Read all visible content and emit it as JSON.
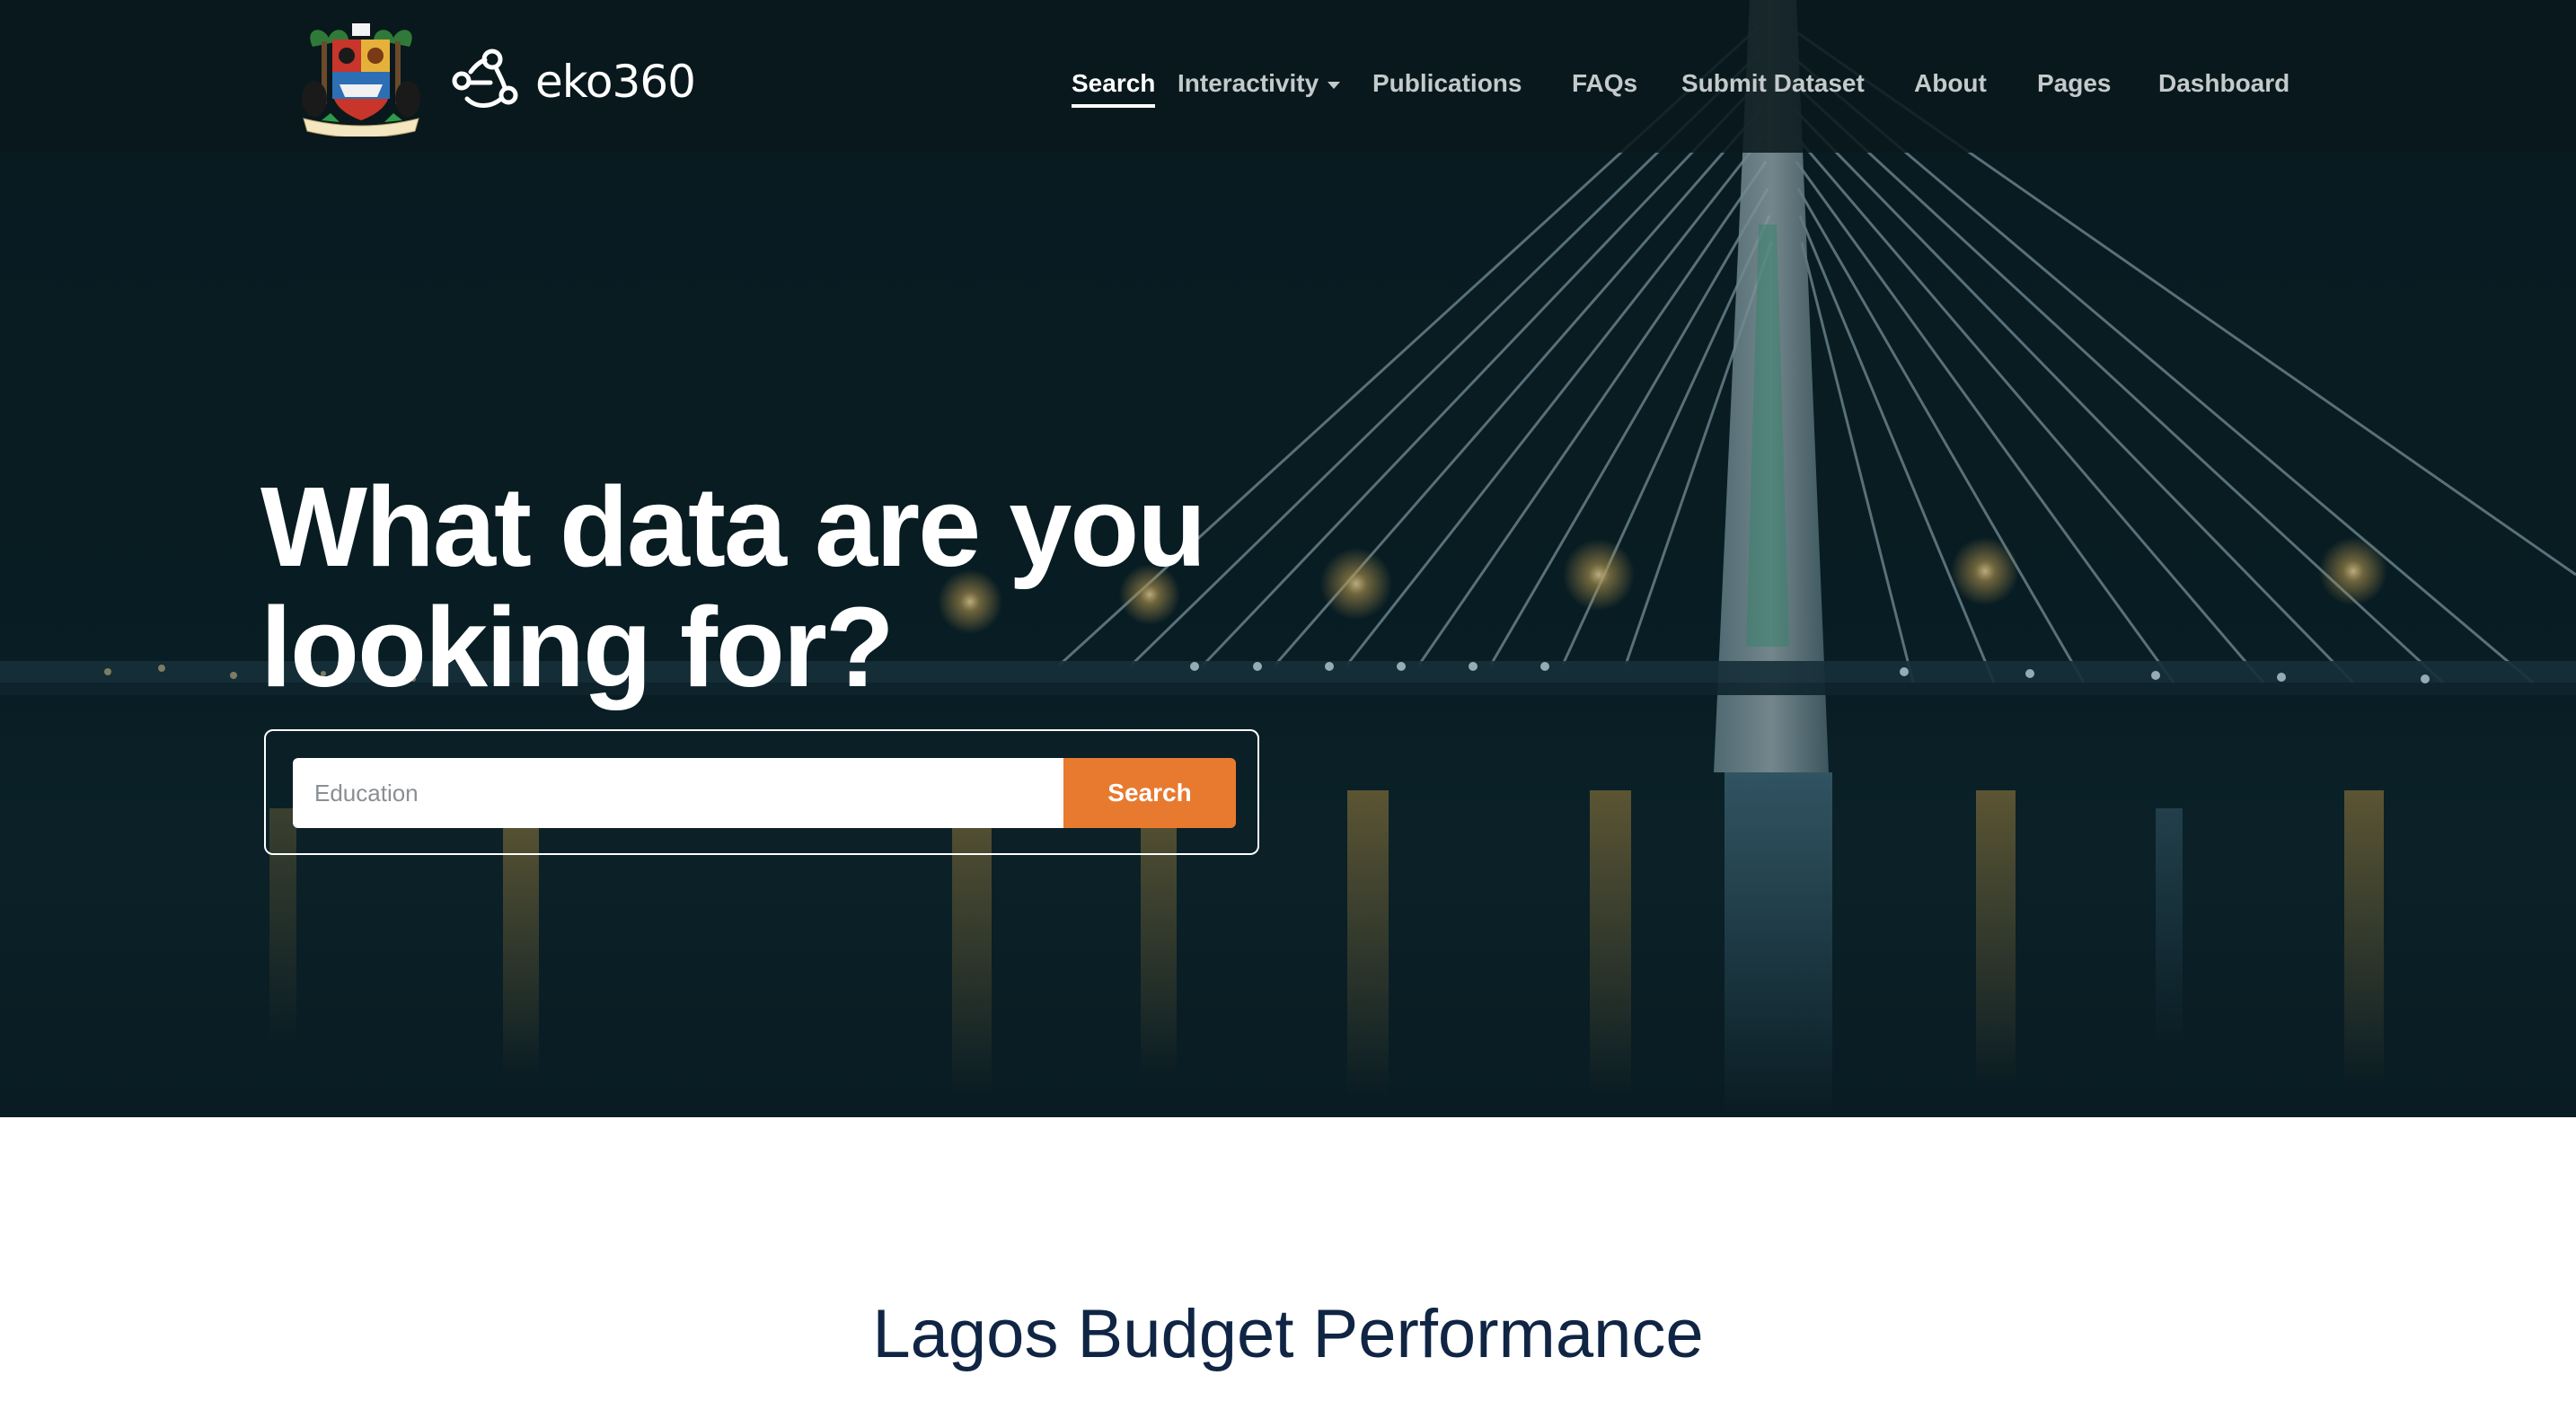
{
  "brand": {
    "name": "eko360",
    "coat_of_arms_icon": "lagos-coat-of-arms",
    "logo_icon": "network-nodes-icon"
  },
  "nav": {
    "items": [
      {
        "label": "Search",
        "active": true
      },
      {
        "label": "Interactivity",
        "dropdown": true
      },
      {
        "label": "Publications"
      },
      {
        "label": "FAQs"
      },
      {
        "label": "Submit Dataset"
      },
      {
        "label": "About"
      },
      {
        "label": "Pages"
      },
      {
        "label": "Dashboard"
      }
    ]
  },
  "hero": {
    "headline_line1": "What data are you",
    "headline_line2": "looking for?",
    "background": "night photo of cable-stayed bridge over water"
  },
  "search": {
    "placeholder": "Education",
    "button_label": "Search"
  },
  "section": {
    "title": "Lagos Budget Performance"
  },
  "colors": {
    "accent": "#e87a2f",
    "nav_bg": "#09181c",
    "title_text": "#102544"
  }
}
